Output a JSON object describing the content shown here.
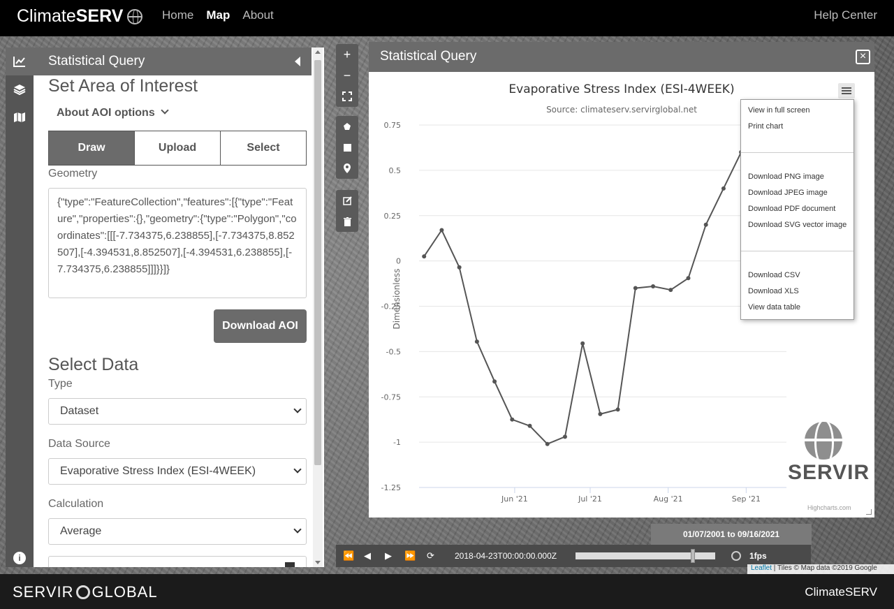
{
  "topbar": {
    "brand_prefix": "Climate",
    "brand_bold": "SERV",
    "nav": [
      "Home",
      "Map",
      "About"
    ],
    "active_nav": "Map",
    "help": "Help Center"
  },
  "panel": {
    "title": "Statistical Query",
    "aoi_heading": "Set Area of Interest",
    "aoi_options": "About AOI options",
    "tabs": [
      "Draw",
      "Upload",
      "Select"
    ],
    "geometry_label": "Geometry",
    "geometry_value": "{\"type\":\"FeatureCollection\",\"features\":[{\"type\":\"Feature\",\"properties\":{},\"geometry\":{\"type\":\"Polygon\",\"coordinates\":[[[-7.734375,6.238855],[-7.734375,8.852507],[-4.394531,8.852507],[-4.394531,6.238855],[-7.734375,6.238855]]]}}]}",
    "download_aoi": "Download AOI",
    "data_heading": "Select Data",
    "type_label": "Type",
    "type_value": "Dataset",
    "source_label": "Data Source",
    "source_value": "Evaporative Stress Index (ESI-4WEEK)",
    "calc_label": "Calculation",
    "calc_value": "Average"
  },
  "query_window": {
    "title": "Statistical Query",
    "close": "×"
  },
  "chart_data": {
    "type": "line",
    "title": "Evaporative Stress Index (ESI-4WEEK)",
    "subtitle": "Source: climateserv.servirglobal.net",
    "xlabel": "",
    "ylabel": "Dimensionless",
    "ylim": [
      -1.25,
      0.75
    ],
    "yticks": [
      0.75,
      0.5,
      0.25,
      0,
      -0.25,
      -0.5,
      -0.75,
      -1,
      -1.25
    ],
    "ytick_labels": [
      "0.75",
      "0.5",
      "0.25",
      "0",
      "-0.25",
      "-0.5",
      "-0.75",
      "-1",
      "-1.25"
    ],
    "xlim": [
      "2021-04-24",
      "2021-09-17"
    ],
    "xticks": [
      "2021-06-01",
      "2021-07-01",
      "2021-08-01",
      "2021-09-01"
    ],
    "xtick_labels": [
      "Jun '21",
      "Jul '21",
      "Aug '21",
      "Sep '21"
    ],
    "x": [
      "2021-04-26",
      "2021-05-03",
      "2021-05-10",
      "2021-05-17",
      "2021-05-24",
      "2021-05-31",
      "2021-06-07",
      "2021-06-14",
      "2021-06-21",
      "2021-06-28",
      "2021-07-05",
      "2021-07-12",
      "2021-07-19",
      "2021-07-26",
      "2021-08-02",
      "2021-08-09",
      "2021-08-16",
      "2021-08-23",
      "2021-08-30"
    ],
    "values": [
      0.025,
      0.17,
      -0.035,
      -0.445,
      -0.665,
      -0.875,
      -0.91,
      -1.01,
      -0.97,
      -0.455,
      -0.845,
      -0.82,
      -0.15,
      -0.14,
      -0.16,
      -0.095,
      0.2,
      0.4,
      0.6
    ],
    "color": "#555555",
    "grid": true,
    "legend": "none"
  },
  "chart_menu": {
    "group1": [
      "View in full screen",
      "Print chart"
    ],
    "group2": [
      "Download PNG image",
      "Download JPEG image",
      "Download PDF document",
      "Download SVG vector image"
    ],
    "group3": [
      "Download CSV",
      "Download XLS",
      "View data table"
    ]
  },
  "servir_logo": "SERVIR",
  "credits": "Highcharts.com",
  "timeline": {
    "date_range": "01/07/2001 to 09/16/2021",
    "timestamp": "2018-04-23T00:00:00.000Z",
    "fps": "1fps",
    "progress": 0.84
  },
  "attribution": {
    "leaflet": "Leaflet",
    "rest": " | Tiles © Map data ©2019 Google"
  },
  "footer": {
    "left_a": "SERVIR",
    "left_b": "GLOBAL",
    "right": "ClimateSERV"
  }
}
